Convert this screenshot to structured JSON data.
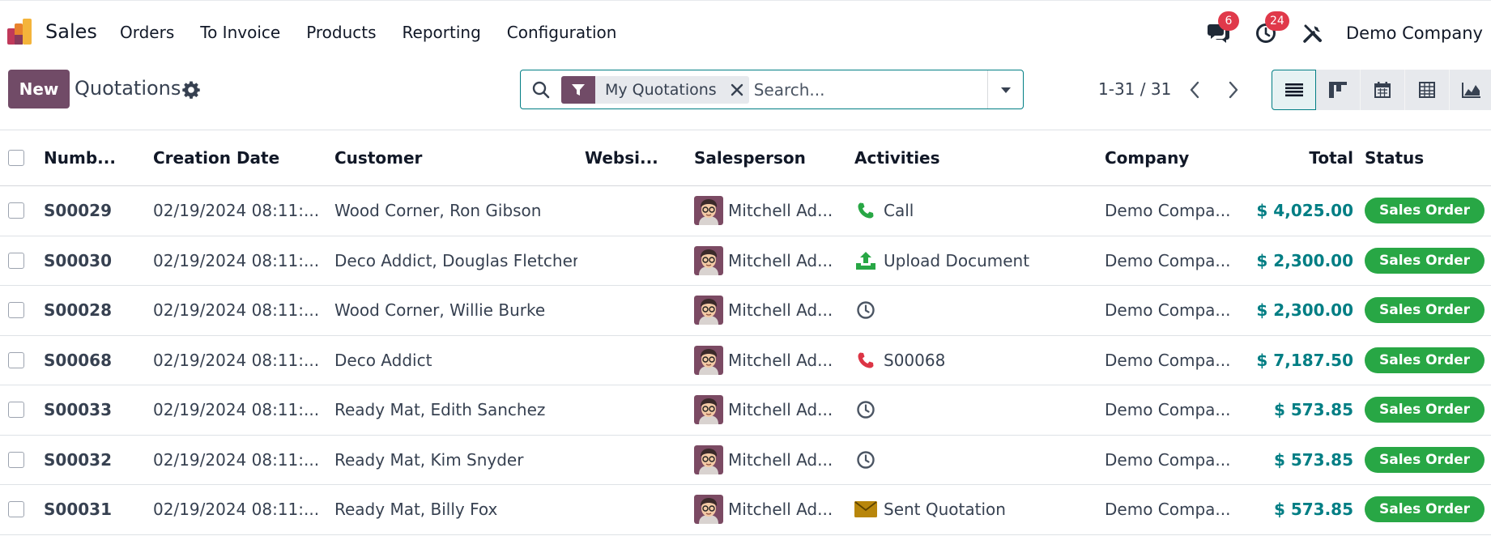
{
  "app": {
    "name": "Sales"
  },
  "menu": [
    "Orders",
    "To Invoice",
    "Products",
    "Reporting",
    "Configuration"
  ],
  "systray": {
    "messages_count": "6",
    "activities_count": "24",
    "company": "Demo Company"
  },
  "control": {
    "new_label": "New",
    "breadcrumb": "Quotations",
    "facet_label": "My Quotations",
    "search_placeholder": "Search...",
    "pager": "1-31 / 31"
  },
  "colors": {
    "brand": "#714b67",
    "accent": "#017e84",
    "status_green": "#28a745",
    "badge_red": "#e0394a"
  },
  "table": {
    "columns": [
      "Numb...",
      "Creation Date",
      "Customer",
      "Websi...",
      "Salesperson",
      "Activities",
      "Company",
      "Total",
      "Status"
    ],
    "rows": [
      {
        "number": "S00029",
        "date": "02/19/2024 08:11:...",
        "customer": "Wood Corner, Ron Gibson",
        "website": "",
        "salesperson": "Mitchell Ad...",
        "activity_icon": "phone-icon",
        "activity": "Call",
        "company": "Demo Compa...",
        "total": "$ 4,025.00",
        "status": "Sales Order"
      },
      {
        "number": "S00030",
        "date": "02/19/2024 08:11:...",
        "customer": "Deco Addict, Douglas Fletcher",
        "website": "",
        "salesperson": "Mitchell Ad...",
        "activity_icon": "upload-icon",
        "activity": "Upload Document",
        "company": "Demo Compa...",
        "total": "$ 2,300.00",
        "status": "Sales Order"
      },
      {
        "number": "S00028",
        "date": "02/19/2024 08:11:...",
        "customer": "Wood Corner, Willie Burke",
        "website": "",
        "salesperson": "Mitchell Ad...",
        "activity_icon": "clock-icon",
        "activity": "",
        "company": "Demo Compa...",
        "total": "$ 2,300.00",
        "status": "Sales Order"
      },
      {
        "number": "S00068",
        "date": "02/19/2024 08:11:...",
        "customer": "Deco Addict",
        "website": "",
        "salesperson": "Mitchell Ad...",
        "activity_icon": "phone-overdue-icon",
        "activity": "S00068",
        "company": "Demo Compa...",
        "total": "$ 7,187.50",
        "status": "Sales Order"
      },
      {
        "number": "S00033",
        "date": "02/19/2024 08:11:...",
        "customer": "Ready Mat, Edith Sanchez",
        "website": "",
        "salesperson": "Mitchell Ad...",
        "activity_icon": "clock-icon",
        "activity": "",
        "company": "Demo Compa...",
        "total": "$ 573.85",
        "status": "Sales Order"
      },
      {
        "number": "S00032",
        "date": "02/19/2024 08:11:...",
        "customer": "Ready Mat, Kim Snyder",
        "website": "",
        "salesperson": "Mitchell Ad...",
        "activity_icon": "clock-icon",
        "activity": "",
        "company": "Demo Compa...",
        "total": "$ 573.85",
        "status": "Sales Order"
      },
      {
        "number": "S00031",
        "date": "02/19/2024 08:11:...",
        "customer": "Ready Mat, Billy Fox",
        "website": "",
        "salesperson": "Mitchell Ad...",
        "activity_icon": "envelope-icon",
        "activity": "Sent Quotation",
        "company": "Demo Compa...",
        "total": "$ 573.85",
        "status": "Sales Order"
      }
    ]
  }
}
